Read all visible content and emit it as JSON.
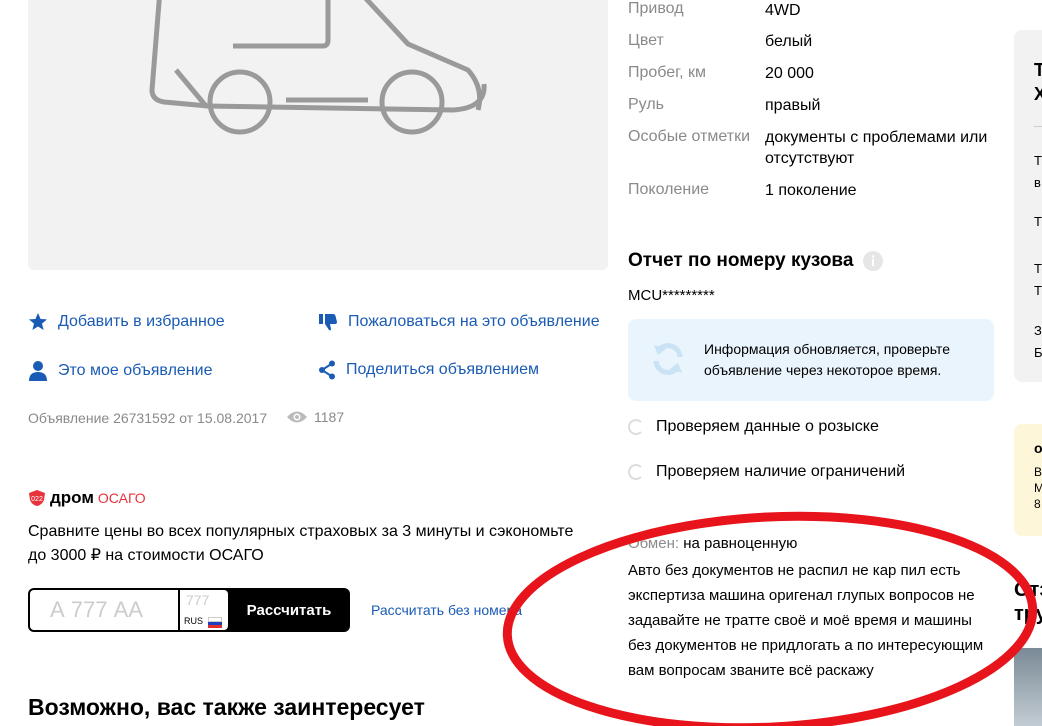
{
  "specs": [
    {
      "label": "Привод",
      "value": "4WD"
    },
    {
      "label": "Цвет",
      "value": "белый"
    },
    {
      "label": "Пробег, км",
      "value": "20 000"
    },
    {
      "label": "Руль",
      "value": "правый"
    },
    {
      "label": "Особые отметки",
      "value": "документы с проблемами или отсутствуют"
    },
    {
      "label": "Поколение",
      "value": "1 поколение"
    }
  ],
  "actions": {
    "favorite": "Добавить в избранное",
    "report": "Пожаловаться на это объявление",
    "mine": "Это мое объявление",
    "share": "Поделиться объявлением"
  },
  "listing_meta": {
    "text": "Объявление 26731592 от 15.08.2017",
    "views": "1187"
  },
  "osago": {
    "brand": "дром",
    "brand_suffix": "ОСАГО",
    "description": "Сравните цены во всех популярных страховых за 3 минуты и сэкономьте до 3000 ₽ на стоимости ОСАГО",
    "plate_placeholder": "А 777 АА",
    "region_placeholder": "777",
    "region_country": "RUS",
    "calc_button": "Рассчитать",
    "calc_without_plate": "Рассчитать без номера"
  },
  "recommendations_title": "Возможно, вас также заинтересует",
  "report": {
    "title": "Отчет по номеру кузова",
    "body_number": "MCU*********",
    "info_text": "Информация обновляется, проверьте объявление через некоторое время.",
    "checks": [
      "Проверяем данные о розыске",
      "Проверяем наличие ограничений"
    ]
  },
  "exchange": {
    "label": "Обмен:",
    "value": "на равноценную"
  },
  "description": "Авто без документов не распил не кар пил есть экспертиза машина оригенал глупых вопросов не задавайте не тратте своё и моё время и машины без документов не придлогать а по интересующим вам вопросам званите всё раскажу",
  "side_partial": {
    "card_title": "Т Х",
    "lines": [
      "Т в",
      "Т",
      "Т Т",
      "З Б"
    ],
    "yellow_lines": [
      "о",
      "В М 8"
    ],
    "reviews_heading": "Отз тру"
  },
  "colors": {
    "link": "#1a5bb5",
    "red_annotation": "#e8141b",
    "osago_red": "#e8333c"
  }
}
